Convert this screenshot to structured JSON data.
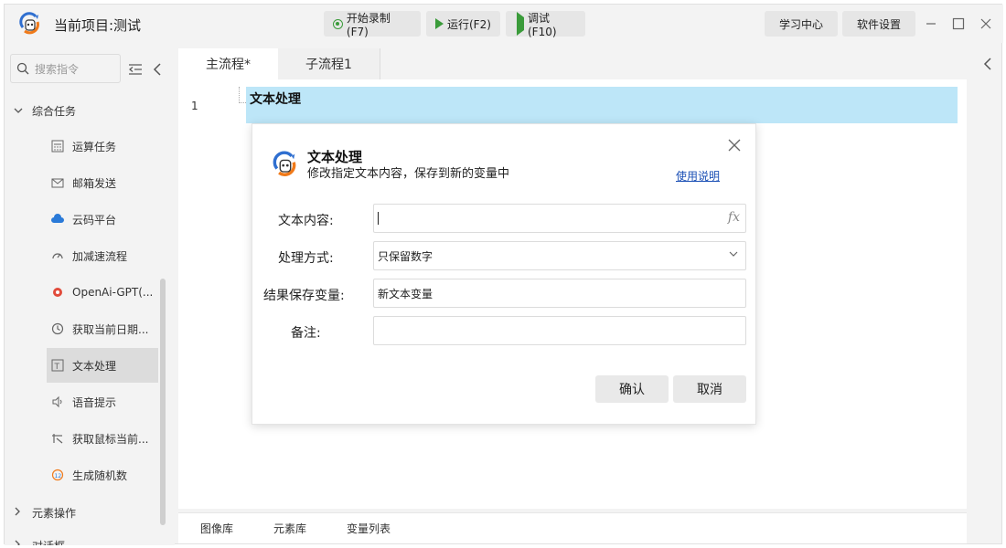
{
  "app": {
    "title": "当前项目:测试",
    "toolbar": {
      "record": "开始录制(F7)",
      "run": "运行(F2)",
      "debug": "调试(F10)",
      "learn": "学习中心",
      "settings": "软件设置"
    }
  },
  "sidebar": {
    "search_placeholder": "搜索指令",
    "group_expanded": "综合任务",
    "items": [
      {
        "label": "运算任务"
      },
      {
        "label": "邮箱发送"
      },
      {
        "label": "云码平台"
      },
      {
        "label": "加减速流程"
      },
      {
        "label": "OpenAi-GPT(..."
      },
      {
        "label": "获取当前日期..."
      },
      {
        "label": "文本处理"
      },
      {
        "label": "语音提示"
      },
      {
        "label": "获取鼠标当前..."
      },
      {
        "label": "生成随机数"
      }
    ],
    "group_collapsed_1": "元素操作",
    "group_collapsed_2": "对话框"
  },
  "tabs": {
    "main": "主流程*",
    "sub": "子流程1"
  },
  "editor": {
    "line_number": "1",
    "line_text": "文本处理"
  },
  "bottom_tabs": {
    "image_lib": "图像库",
    "element_lib": "元素库",
    "var_list": "变量列表"
  },
  "dialog": {
    "title": "文本处理",
    "subtitle": "修改指定文本内容，保存到新的变量中",
    "help": "使用说明",
    "fields": {
      "content_label": "文本内容:",
      "content_value": "",
      "method_label": "处理方式:",
      "method_value": "只保留数字",
      "result_label": "结果保存变量:",
      "result_value": "新文本变量",
      "note_label": "备注:",
      "note_value": ""
    },
    "confirm": "确认",
    "cancel": "取消"
  },
  "colors": {
    "accent_green": "#3a9b3a",
    "highlight_row": "#bde6f8",
    "link_blue": "#1a4fb5"
  }
}
